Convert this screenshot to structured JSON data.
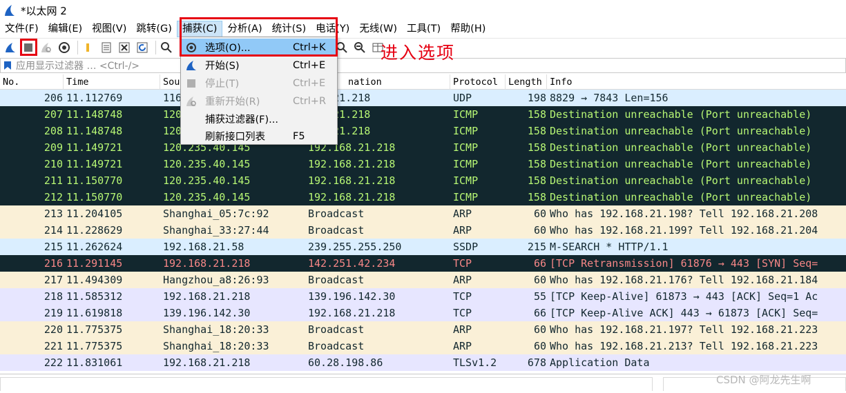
{
  "window": {
    "title": "*以太网 2"
  },
  "menubar": [
    "文件(F)",
    "编辑(E)",
    "视图(V)",
    "跳转(G)",
    "捕获(C)",
    "分析(A)",
    "统计(S)",
    "电话(Y)",
    "无线(W)",
    "工具(T)",
    "帮助(H)"
  ],
  "filter": {
    "placeholder": "应用显示过滤器 … <Ctrl-/>"
  },
  "columns": {
    "no": "No.",
    "time": "Time",
    "source": "Sou",
    "destination": "nation",
    "protocol": "Protocol",
    "length": "Length",
    "info": "Info"
  },
  "packets": [
    {
      "no": "206",
      "time": "11.112769",
      "source": "116",
      "destination": "168.21.218",
      "protocol": "UDP",
      "length": "198",
      "info": "8829 → 7843 Len=156",
      "color": "udp"
    },
    {
      "no": "207",
      "time": "11.148748",
      "source": "120",
      "destination": "168.21.218",
      "protocol": "ICMP",
      "length": "158",
      "info": "Destination unreachable (Port unreachable)",
      "color": "icmp"
    },
    {
      "no": "208",
      "time": "11.148748",
      "source": "120",
      "destination": "168.21.218",
      "protocol": "ICMP",
      "length": "158",
      "info": "Destination unreachable (Port unreachable)",
      "color": "icmp"
    },
    {
      "no": "209",
      "time": "11.149721",
      "source": "120.235.40.145",
      "destination": "192.168.21.218",
      "protocol": "ICMP",
      "length": "158",
      "info": "Destination unreachable (Port unreachable)",
      "color": "icmp"
    },
    {
      "no": "210",
      "time": "11.149721",
      "source": "120.235.40.145",
      "destination": "192.168.21.218",
      "protocol": "ICMP",
      "length": "158",
      "info": "Destination unreachable (Port unreachable)",
      "color": "icmp"
    },
    {
      "no": "211",
      "time": "11.150770",
      "source": "120.235.40.145",
      "destination": "192.168.21.218",
      "protocol": "ICMP",
      "length": "158",
      "info": "Destination unreachable (Port unreachable)",
      "color": "icmp"
    },
    {
      "no": "212",
      "time": "11.150770",
      "source": "120.235.40.145",
      "destination": "192.168.21.218",
      "protocol": "ICMP",
      "length": "158",
      "info": "Destination unreachable (Port unreachable)",
      "color": "icmp"
    },
    {
      "no": "213",
      "time": "11.204105",
      "source": "Shanghai_05:7c:92",
      "destination": "Broadcast",
      "protocol": "ARP",
      "length": "60",
      "info": "Who has 192.168.21.198? Tell 192.168.21.208",
      "color": "arp"
    },
    {
      "no": "214",
      "time": "11.228629",
      "source": "Shanghai_33:27:44",
      "destination": "Broadcast",
      "protocol": "ARP",
      "length": "60",
      "info": "Who has 192.168.21.199? Tell 192.168.21.204",
      "color": "arp"
    },
    {
      "no": "215",
      "time": "11.262624",
      "source": "192.168.21.58",
      "destination": "239.255.255.250",
      "protocol": "SSDP",
      "length": "215",
      "info": "M-SEARCH * HTTP/1.1",
      "color": "udp"
    },
    {
      "no": "216",
      "time": "11.291145",
      "source": "192.168.21.218",
      "destination": "142.251.42.234",
      "protocol": "TCP",
      "length": "66",
      "info": "[TCP Retransmission] 61876 → 443 [SYN] Seq=",
      "color": "bad"
    },
    {
      "no": "217",
      "time": "11.494309",
      "source": "Hangzhou_a8:26:93",
      "destination": "Broadcast",
      "protocol": "ARP",
      "length": "60",
      "info": "Who has 192.168.21.176? Tell 192.168.21.184",
      "color": "arp"
    },
    {
      "no": "218",
      "time": "11.585312",
      "source": "192.168.21.218",
      "destination": "139.196.142.30",
      "protocol": "TCP",
      "length": "55",
      "info": "[TCP Keep-Alive] 61873 → 443 [ACK] Seq=1 Ac",
      "color": "tcp"
    },
    {
      "no": "219",
      "time": "11.619818",
      "source": "139.196.142.30",
      "destination": "192.168.21.218",
      "protocol": "TCP",
      "length": "66",
      "info": "[TCP Keep-Alive ACK] 443 → 61873 [ACK] Seq=",
      "color": "tcp"
    },
    {
      "no": "220",
      "time": "11.775375",
      "source": "Shanghai_18:20:33",
      "destination": "Broadcast",
      "protocol": "ARP",
      "length": "60",
      "info": "Who has 192.168.21.197? Tell 192.168.21.223",
      "color": "arp"
    },
    {
      "no": "221",
      "time": "11.775375",
      "source": "Shanghai_18:20:33",
      "destination": "Broadcast",
      "protocol": "ARP",
      "length": "60",
      "info": "Who has 192.168.21.213? Tell 192.168.21.223",
      "color": "arp"
    },
    {
      "no": "222",
      "time": "11.831061",
      "source": "192.168.21.218",
      "destination": "60.28.198.86",
      "protocol": "TLSv1.2",
      "length": "678",
      "info": "Application Data",
      "color": "tcp"
    }
  ],
  "row_colors": {
    "udp": {
      "bg": "#daeeff",
      "fg": "#12272e"
    },
    "icmp": {
      "bg": "#12272e",
      "fg": "#b7f774"
    },
    "arp": {
      "bg": "#faf0d7",
      "fg": "#12272e"
    },
    "bad": {
      "bg": "#12272e",
      "fg": "#f78787"
    },
    "tcp": {
      "bg": "#e7e6ff",
      "fg": "#12272e"
    }
  },
  "capture_menu": {
    "items": [
      {
        "label": "选项(O)...",
        "shortcut": "Ctrl+K",
        "icon": "gear-icon",
        "state": "highlight"
      },
      {
        "label": "开始(S)",
        "shortcut": "Ctrl+E",
        "icon": "shark-fin-icon",
        "state": "normal"
      },
      {
        "label": "停止(T)",
        "shortcut": "Ctrl+E",
        "icon": "stop-icon",
        "state": "disabled"
      },
      {
        "label": "重新开始(R)",
        "shortcut": "Ctrl+R",
        "icon": "restart-icon",
        "state": "disabled"
      },
      {
        "label": "捕获过滤器(F)...",
        "shortcut": "",
        "icon": "",
        "state": "normal"
      },
      {
        "label": "刷新接口列表",
        "shortcut": "F5",
        "icon": "",
        "state": "normal"
      }
    ]
  },
  "annotation": "进入选项",
  "watermark": "CSDN @阿龙先生啊",
  "colors": {
    "highlight_red": "#e60012",
    "menu_highlight": "#91c9f7",
    "wireshark_blue": "#1e63c3"
  }
}
